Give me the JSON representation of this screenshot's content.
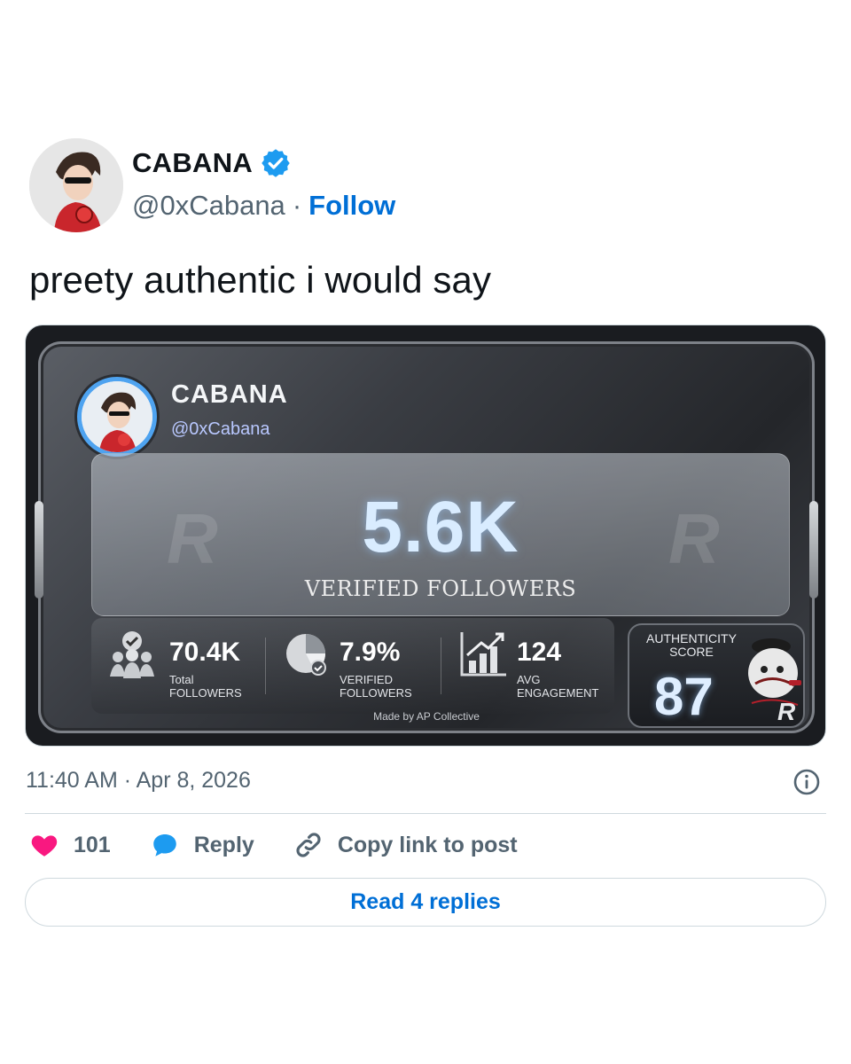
{
  "author": {
    "display_name": "CABANA",
    "handle": "@0xCabana",
    "separator": "·",
    "follow_label": "Follow"
  },
  "tweet": {
    "text": "preety authentic i would say"
  },
  "card": {
    "name": "CABANA",
    "handle": "@0xCabana",
    "big_number": "5.6K",
    "big_label": "VERIFIED FOLLOWERS",
    "stats": [
      {
        "value": "70.4K",
        "label_line1": "Total",
        "label_line2": "FOLLOWERS",
        "icon": "users-badge-icon"
      },
      {
        "value": "7.9%",
        "label_line1": "VERIFIED",
        "label_line2": "FOLLOWERS",
        "icon": "pie-check-icon"
      },
      {
        "value": "124",
        "label_line1": "AVG",
        "label_line2": "ENGAGEMENT",
        "icon": "bar-chart-arrow-icon"
      }
    ],
    "authenticity_label_1": "AUTHENTICITY",
    "authenticity_label_2": "SCORE",
    "authenticity_score": "87",
    "made_by": "Made by AP Collective",
    "logo_text": "R"
  },
  "meta": {
    "timestamp": "11:40 AM · Apr 8, 2026"
  },
  "actions": {
    "like_count": "101",
    "reply_label": "Reply",
    "copy_label": "Copy link to post"
  },
  "read_replies_label": "Read 4 replies",
  "colors": {
    "link": "#006fd6",
    "heart": "#f91880",
    "reply": "#1d9bf0",
    "muted": "#536471",
    "verified": "#1d9bf0"
  }
}
